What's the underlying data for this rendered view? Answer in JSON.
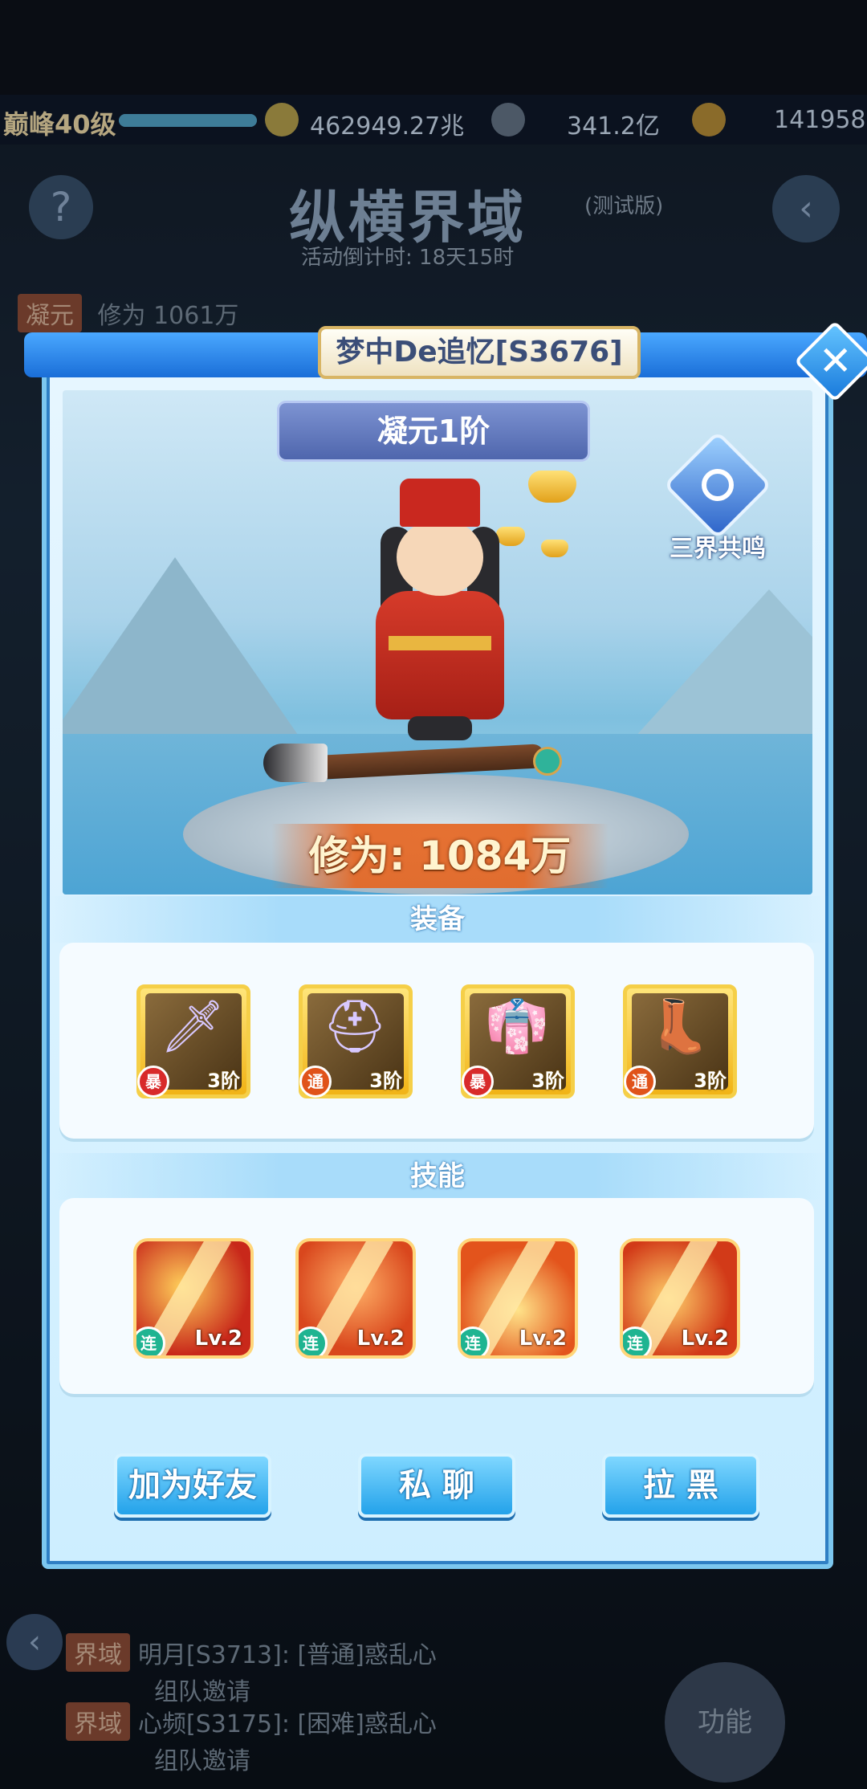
{
  "background": {
    "level": "巅峰40级",
    "currency1": "462949.27兆",
    "currency2": "341.2亿",
    "currency3": "141958",
    "event_title": "纵横界域",
    "event_note": "(测试版)",
    "countdown": "活动倒计时: 18天15时",
    "bg_power": "修为 1061万",
    "bg_tag1": "凝元",
    "chat": [
      {
        "tag": "界域",
        "name": "明月[S3713]",
        "text": ": [普通]惑乱心",
        "sub": "组队邀请"
      },
      {
        "tag": "界域",
        "name": "心频[S3175]",
        "text": ": [困难]惑乱心",
        "sub": "组队邀请"
      }
    ],
    "func_label": "功能"
  },
  "modal": {
    "player_name": "梦中De追忆[S3676]",
    "rank": "凝元1阶",
    "resonance_label": "三界共鸣",
    "power": "修为: 1084万",
    "equipment_title": "装备",
    "equipment": [
      {
        "icon": "sword-icon",
        "badge": "暴",
        "tier": "3阶"
      },
      {
        "icon": "helmet-icon",
        "badge": "通",
        "tier": "3阶"
      },
      {
        "icon": "robe-icon",
        "badge": "暴",
        "tier": "3阶"
      },
      {
        "icon": "boots-icon",
        "badge": "通",
        "tier": "3阶"
      }
    ],
    "skills_title": "技能",
    "skills": [
      {
        "icon": "lightning-skill-icon",
        "badge": "连",
        "level": "Lv.2",
        "color": "#c8281a"
      },
      {
        "icon": "blade-skill-icon",
        "badge": "连",
        "level": "Lv.2",
        "color": "#d9471d"
      },
      {
        "icon": "flame-skill-icon",
        "badge": "连",
        "level": "Lv.2",
        "color": "#e3541c"
      },
      {
        "icon": "vortex-skill-icon",
        "badge": "连",
        "level": "Lv.2",
        "color": "#d23a18"
      }
    ],
    "buttons": {
      "add_friend": "加为好友",
      "private_chat": "私 聊",
      "block": "拉 黑"
    }
  }
}
